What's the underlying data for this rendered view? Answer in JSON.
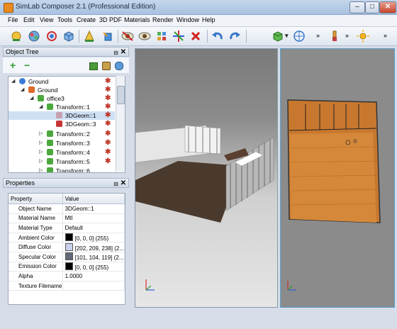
{
  "window": {
    "title": "SimLab Composer 2.1  (Professional Edition)",
    "buttons": {
      "minimize": "–",
      "maximize": "□",
      "close": "✕"
    }
  },
  "menu": [
    "File",
    "Edit",
    "View",
    "Tools",
    "Create",
    "3D PDF",
    "Materials",
    "Render",
    "Window",
    "Help"
  ],
  "toolbar": {
    "icons": [
      "add-scene-icon",
      "materials-icon",
      "transform-icon",
      "cube-icon",
      "lamp-icon",
      "paint-bucket-icon",
      "hide-icon",
      "show-icon",
      "explode-icon",
      "delete-icon",
      "undo-icon",
      "redo-icon",
      "green-cube-icon",
      "target-icon",
      "brush-icon",
      "sun-icon"
    ],
    "overflow": "»"
  },
  "object_tree": {
    "title": "Object Tree",
    "tools": {
      "add": "+",
      "remove": "−"
    },
    "items": [
      {
        "label": "Ground",
        "level": 0,
        "twisty": "◢"
      },
      {
        "label": "Ground",
        "level": 1,
        "twisty": "◢"
      },
      {
        "label": "office3",
        "level": 2,
        "twisty": "◢"
      },
      {
        "label": "Transform::1",
        "level": 3,
        "twisty": "◢"
      },
      {
        "label": "3DGeom::1",
        "level": 4,
        "twisty": ""
      },
      {
        "label": "3DGeom::3",
        "level": 4,
        "twisty": ""
      },
      {
        "label": "Transform::2",
        "level": 3,
        "twisty": "▷"
      },
      {
        "label": "Transform::3",
        "level": 3,
        "twisty": "▷"
      },
      {
        "label": "Transform::4",
        "level": 3,
        "twisty": "▷"
      },
      {
        "label": "Transform::5",
        "level": 3,
        "twisty": "▷"
      },
      {
        "label": "Transform::6",
        "level": 3,
        "twisty": "▷"
      }
    ]
  },
  "properties": {
    "title": "Properties",
    "headers": [
      "Property",
      "Value"
    ],
    "rows": [
      {
        "name": "Object Name",
        "value": "3DGeom::1",
        "swatch": ""
      },
      {
        "name": "Material Name",
        "value": "Mtl",
        "swatch": ""
      },
      {
        "name": "Material Type",
        "value": "Default",
        "swatch": ""
      },
      {
        "name": "Ambient Color",
        "value": "[0, 0, 0] (255)",
        "swatch": "#000000"
      },
      {
        "name": "Diffuse Color",
        "value": "[202, 209, 238] (2...",
        "swatch": "#cad1ee"
      },
      {
        "name": "Specular Color",
        "value": "[101, 104, 119] (2...",
        "swatch": "#656877"
      },
      {
        "name": "Emission Color",
        "value": "[0, 0, 0] (255)",
        "swatch": "#000000"
      },
      {
        "name": "Alpha",
        "value": "1.0000",
        "swatch": ""
      },
      {
        "name": "Texture Filename",
        "value": "",
        "swatch": ""
      }
    ]
  },
  "panel_controls": {
    "pin": "⊟",
    "close": "✕"
  },
  "colors": {
    "accent": "#5da0d0",
    "floor": "#c8782e",
    "selection": "#cfe0f5"
  }
}
